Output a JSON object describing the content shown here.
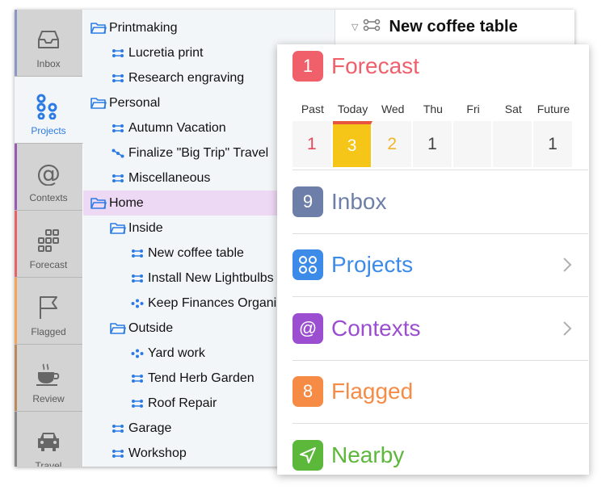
{
  "sidebar": {
    "tabs": [
      {
        "label": "Inbox",
        "icon": "inbox-icon",
        "accent": "#8b97c6"
      },
      {
        "label": "Projects",
        "icon": "projects-icon",
        "accent": "#2c7be5",
        "selected": true
      },
      {
        "label": "Contexts",
        "icon": "at-icon",
        "accent": "#9b59b6"
      },
      {
        "label": "Forecast",
        "icon": "forecast-grid-icon",
        "accent": "#e8626b"
      },
      {
        "label": "Flagged",
        "icon": "flag-icon",
        "accent": "#f2a65a"
      },
      {
        "label": "Review",
        "icon": "coffee-cup-icon",
        "accent": "#b98a5c"
      },
      {
        "label": "Travel",
        "icon": "car-icon",
        "accent": "#888888"
      }
    ]
  },
  "outline": {
    "rows": [
      {
        "label": "Printmaking",
        "type": "folder",
        "indent": 0
      },
      {
        "label": "Lucretia print",
        "type": "parallel",
        "indent": 1
      },
      {
        "label": "Research engraving",
        "type": "parallel",
        "indent": 1
      },
      {
        "label": "Personal",
        "type": "folder",
        "indent": 0
      },
      {
        "label": "Autumn Vacation",
        "type": "parallel",
        "indent": 1
      },
      {
        "label": "Finalize \"Big Trip\" Travel",
        "type": "sequential",
        "indent": 1
      },
      {
        "label": "Miscellaneous",
        "type": "parallel",
        "indent": 1
      },
      {
        "label": "Home",
        "type": "folder",
        "indent": 0,
        "selected": true
      },
      {
        "label": "Inside",
        "type": "folder",
        "indent": 1
      },
      {
        "label": "New coffee table",
        "type": "parallel",
        "indent": 2
      },
      {
        "label": "Install New Lightbulbs",
        "type": "parallel",
        "indent": 2
      },
      {
        "label": "Keep Finances Organized",
        "type": "single",
        "indent": 2
      },
      {
        "label": "Outside",
        "type": "folder",
        "indent": 1
      },
      {
        "label": "Yard work",
        "type": "single",
        "indent": 2
      },
      {
        "label": "Tend Herb Garden",
        "type": "parallel",
        "indent": 2
      },
      {
        "label": "Roof Repair",
        "type": "parallel",
        "indent": 2
      },
      {
        "label": "Garage",
        "type": "parallel",
        "indent": 1
      },
      {
        "label": "Workshop",
        "type": "parallel",
        "indent": 1
      }
    ]
  },
  "detail": {
    "title": "New coffee table"
  },
  "phone": {
    "forecast": {
      "count": "1",
      "label": "Forecast",
      "color": "#f0606b",
      "days": [
        "Past",
        "Today",
        "Wed",
        "Thu",
        "Fri",
        "Sat",
        "Future"
      ],
      "counts": [
        "1",
        "3",
        "2",
        "1",
        "",
        "",
        "1"
      ],
      "count_colors": [
        "#e8495a",
        "#ffffff",
        "#f0b429",
        "#444444",
        "#444444",
        "#444444",
        "#444444"
      ],
      "today_index": 1
    },
    "sections": [
      {
        "key": "inbox",
        "count": "9",
        "label": "Inbox",
        "color": "#6d7fa8",
        "chevron": false
      },
      {
        "key": "projects",
        "count": "",
        "label": "Projects",
        "color": "#3d8be8",
        "icon": "projects-icon",
        "chevron": true
      },
      {
        "key": "contexts",
        "count": "@",
        "label": "Contexts",
        "color": "#9b4fd0",
        "chevron": true
      },
      {
        "key": "flagged",
        "count": "8",
        "label": "Flagged",
        "color": "#f58b45",
        "chevron": false
      },
      {
        "key": "nearby",
        "count": "",
        "label": "Nearby",
        "color": "#5cb83a",
        "icon": "location-arrow-icon",
        "chevron": false
      }
    ]
  }
}
